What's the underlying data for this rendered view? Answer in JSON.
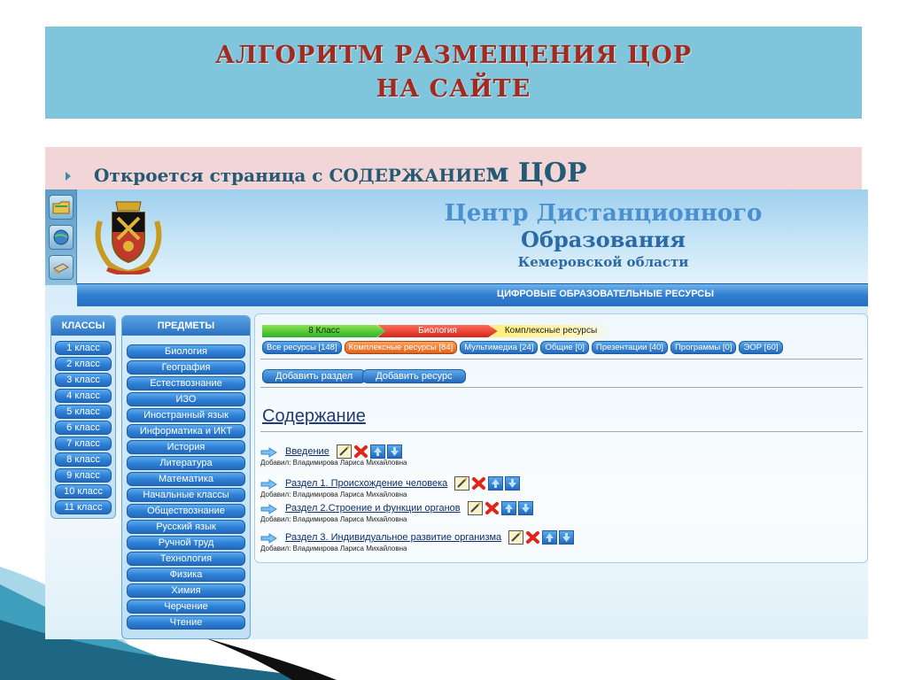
{
  "slide": {
    "title_line1": "АЛГОРИТМ РАЗМЕЩЕНИЯ ЦОР",
    "title_line2": "НА САЙТЕ",
    "bullet_prefix": "Откроется страница с СОДЕРЖАНИЕ",
    "bullet_suffix": "м  ЦОР",
    "colors": {
      "title_band": "#7fc6dc",
      "title_text": "#a32a1e",
      "bullet_band": "#f2d5d7",
      "bullet_text": "#245a73"
    }
  },
  "site": {
    "title_line1": "Центр Дистанционного",
    "title_line2": "Образования",
    "title_line3": "Кемеровской области",
    "nav_label": "ЦИФРОВЫЕ ОБРАЗОВАТЕЛЬНЫЕ РЕСУРСЫ",
    "side_icons": [
      "folder-icon",
      "globe-icon",
      "book-icon"
    ],
    "crest_icon": "coat-of-arms-icon"
  },
  "classes": {
    "header": "КЛАССЫ",
    "items": [
      "1 класс",
      "2 класс",
      "3 класс",
      "4 класс",
      "5 класс",
      "6 класс",
      "7 класс",
      "8 класс",
      "9 класс",
      "10 класс",
      "11 класс"
    ]
  },
  "subjects": {
    "header": "ПРЕДМЕТЫ",
    "items": [
      "Биология",
      "География",
      "Естествознание",
      "ИЗО",
      "Иностранный язык",
      "Информатика и ИКТ",
      "История",
      "Литература",
      "Математика",
      "Начальные классы",
      "Обществознание",
      "Русский язык",
      "Ручной труд",
      "Технология",
      "Физика",
      "Химия",
      "Черчение",
      "Чтение"
    ]
  },
  "main": {
    "breadcrumbs": [
      "8 Класс",
      "Биология",
      "Комплексные ресурсы"
    ],
    "filters": [
      {
        "label": "Все ресурсы [148]",
        "active": false
      },
      {
        "label": "Комплексные ресурсы [84]",
        "active": true
      },
      {
        "label": "Мультимедиа [24]",
        "active": false
      },
      {
        "label": "Общие [0]",
        "active": false
      },
      {
        "label": "Презентации [40]",
        "active": false
      },
      {
        "label": "Программы [0]",
        "active": false
      },
      {
        "label": "ЭОР [60]",
        "active": false
      }
    ],
    "add_section": "Добавить раздел",
    "add_resource": "Добавить ресурс",
    "heading": "Содержание",
    "entries": [
      {
        "title": "Введение",
        "added_by": "Добавил: Владимирова Лариса Михайловна"
      },
      {
        "title": "Раздел 1. Происхождение человека",
        "added_by": "Добавил: Владимирова Лариса Михайловна"
      },
      {
        "title": "Раздел 2.Строение и функции органов",
        "added_by": "Добавил: Владимирова Лариса Михайловна"
      },
      {
        "title": "Раздел 3. Индивидуальное развитие организма",
        "added_by": "Добавил: Владимирова Лариса Михайловна"
      }
    ]
  }
}
